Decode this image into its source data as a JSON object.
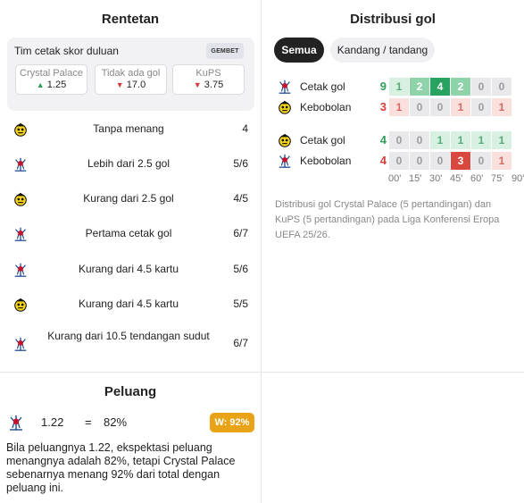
{
  "left_panel": {
    "title": "Rentetan",
    "odds": {
      "heading": "Tim cetak skor duluan",
      "brand": "GEMBET",
      "cells": [
        {
          "name": "Crystal Palace",
          "arrow": "▲",
          "value": "1.25",
          "dir": "up"
        },
        {
          "name": "Tidak ada gol",
          "arrow": "▼",
          "value": "17.0",
          "dir": "down"
        },
        {
          "name": "KuPS",
          "arrow": "▼",
          "value": "3.75",
          "dir": "down"
        }
      ]
    },
    "streaks": [
      {
        "team": "kups",
        "label": "Tanpa menang",
        "value": "4"
      },
      {
        "team": "palace",
        "label": "Lebih dari 2.5 gol",
        "value": "5/6"
      },
      {
        "team": "kups",
        "label": "Kurang dari 2.5 gol",
        "value": "4/5"
      },
      {
        "team": "palace",
        "label": "Pertama cetak gol",
        "value": "6/7"
      },
      {
        "team": "palace",
        "label": "Kurang dari 4.5 kartu",
        "value": "5/6"
      },
      {
        "team": "kups",
        "label": "Kurang dari 4.5 kartu",
        "value": "5/5"
      },
      {
        "team": "palace",
        "label": "Kurang dari 10.5 tendangan sudut",
        "value": "6/7"
      }
    ]
  },
  "right_panel": {
    "title": "Distribusi gol",
    "tabs": [
      {
        "label": "Semua",
        "active": true
      },
      {
        "label": "Kandang / tandang",
        "active": false
      }
    ],
    "groups": [
      {
        "rows": [
          {
            "team": "palace",
            "label": "Cetak gol",
            "total": "9",
            "total_color": "#2e9e5b",
            "cells": [
              "1",
              "2",
              "4",
              "2",
              "0",
              "0"
            ],
            "kind": "scored"
          },
          {
            "team": "kups",
            "label": "Kebobolan",
            "total": "3",
            "total_color": "#d23c3c",
            "cells": [
              "1",
              "0",
              "0",
              "1",
              "0",
              "1"
            ],
            "kind": "conceded"
          }
        ]
      },
      {
        "rows": [
          {
            "team": "kups",
            "label": "Cetak gol",
            "total": "4",
            "total_color": "#2e9e5b",
            "cells": [
              "0",
              "0",
              "1",
              "1",
              "1",
              "1"
            ],
            "kind": "scored"
          },
          {
            "team": "palace",
            "label": "Kebobolan",
            "total": "4",
            "total_color": "#d23c3c",
            "cells": [
              "0",
              "0",
              "0",
              "3",
              "0",
              "1"
            ],
            "kind": "conceded"
          }
        ]
      }
    ],
    "axis": [
      "00'",
      "15'",
      "30'",
      "45'",
      "60'",
      "75'",
      "90'"
    ],
    "description": "Distribusi gol Crystal Palace (5 pertandingan) dan KuPS (5 pertandingan) pada Liga Konferensi Eropa UEFA 25/26."
  },
  "chance_panel": {
    "title": "Peluang",
    "odds": "1.22",
    "equals": "=",
    "percent": "82%",
    "badge": "W: 92%",
    "description": "Bila peluangnya 1.22, ekspektasi peluang menangnya adalah 82%, tetapi Crystal Palace sebenarnya menang 92% dari total dengan peluang ini."
  },
  "colors": {
    "scored_high": "#27a35f",
    "scored_mid": "#8fd3ab",
    "scored_low": "#d8f0e2",
    "conceded_high": "#d9483f",
    "conceded_mid": "#f1a8a1",
    "conceded_low": "#fae0dd",
    "zero": "#e9e9ec",
    "badge": "#e8a317"
  }
}
